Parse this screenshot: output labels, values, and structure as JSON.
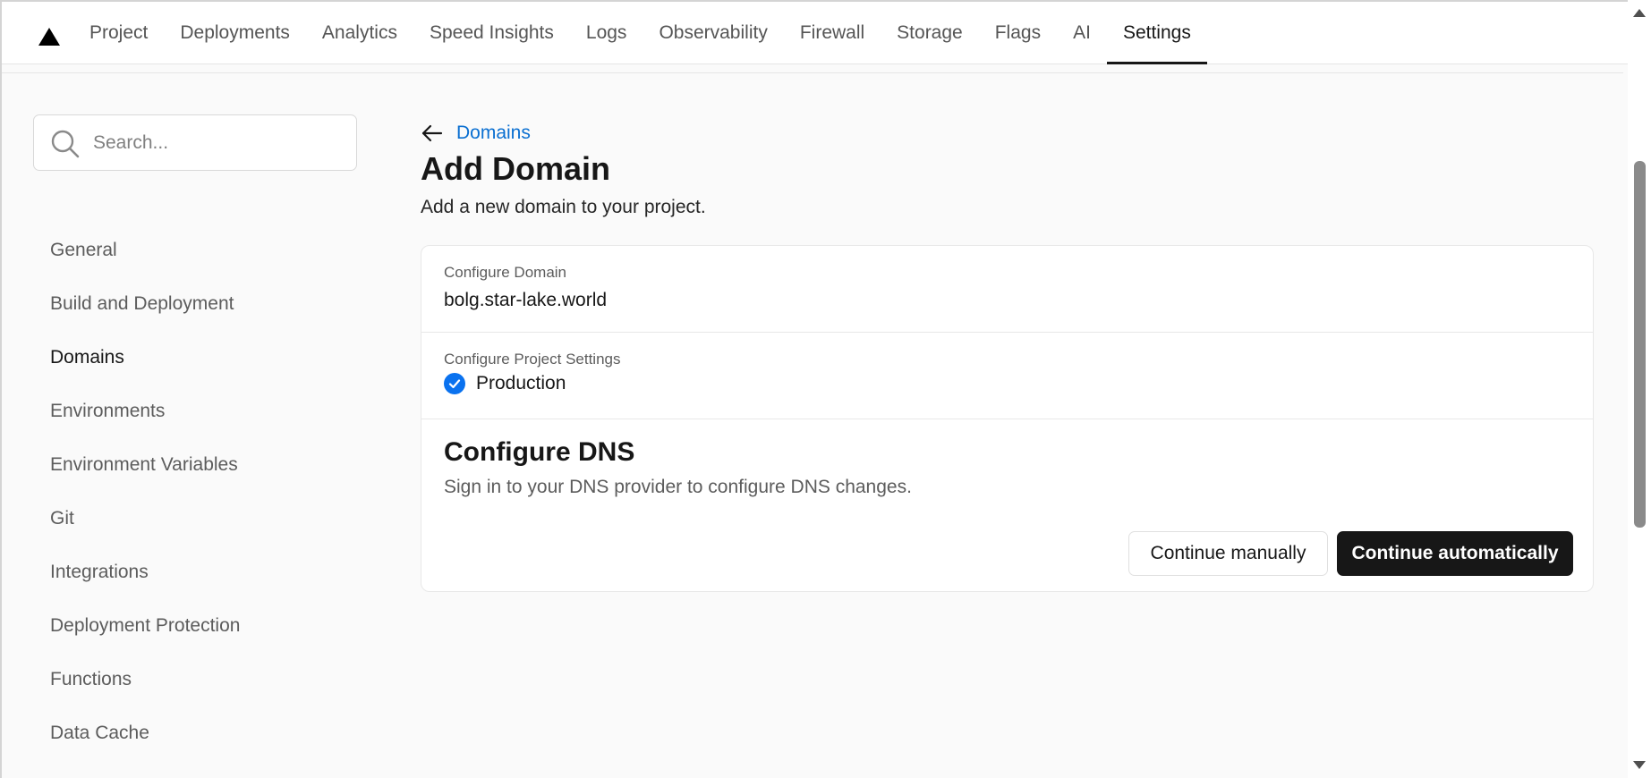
{
  "nav": {
    "tabs": [
      {
        "label": "Project"
      },
      {
        "label": "Deployments"
      },
      {
        "label": "Analytics"
      },
      {
        "label": "Speed Insights"
      },
      {
        "label": "Logs"
      },
      {
        "label": "Observability"
      },
      {
        "label": "Firewall"
      },
      {
        "label": "Storage"
      },
      {
        "label": "Flags"
      },
      {
        "label": "AI"
      },
      {
        "label": "Settings"
      }
    ],
    "active_tab": "Settings",
    "logo_icon": "triangle-logo-icon"
  },
  "sidebar": {
    "search_placeholder": "Search...",
    "items": [
      {
        "label": "General"
      },
      {
        "label": "Build and Deployment"
      },
      {
        "label": "Domains"
      },
      {
        "label": "Environments"
      },
      {
        "label": "Environment Variables"
      },
      {
        "label": "Git"
      },
      {
        "label": "Integrations"
      },
      {
        "label": "Deployment Protection"
      },
      {
        "label": "Functions"
      },
      {
        "label": "Data Cache"
      }
    ],
    "active_item": "Domains"
  },
  "main": {
    "back_label": "Domains",
    "title": "Add Domain",
    "subtitle": "Add a new domain to your project.",
    "configure_domain": {
      "label": "Configure Domain",
      "value": "bolg.star-lake.world"
    },
    "configure_project_settings": {
      "label": "Configure Project Settings",
      "environment": "Production",
      "checked": true
    },
    "configure_dns": {
      "title": "Configure DNS",
      "description": "Sign in to your DNS provider to configure DNS changes."
    },
    "buttons": {
      "manual": "Continue manually",
      "automatic": "Continue automatically"
    }
  },
  "colors": {
    "link": "#0a6fd1",
    "check": "#0a72ef",
    "primary_button": "#171717",
    "background": "#fafafa"
  }
}
